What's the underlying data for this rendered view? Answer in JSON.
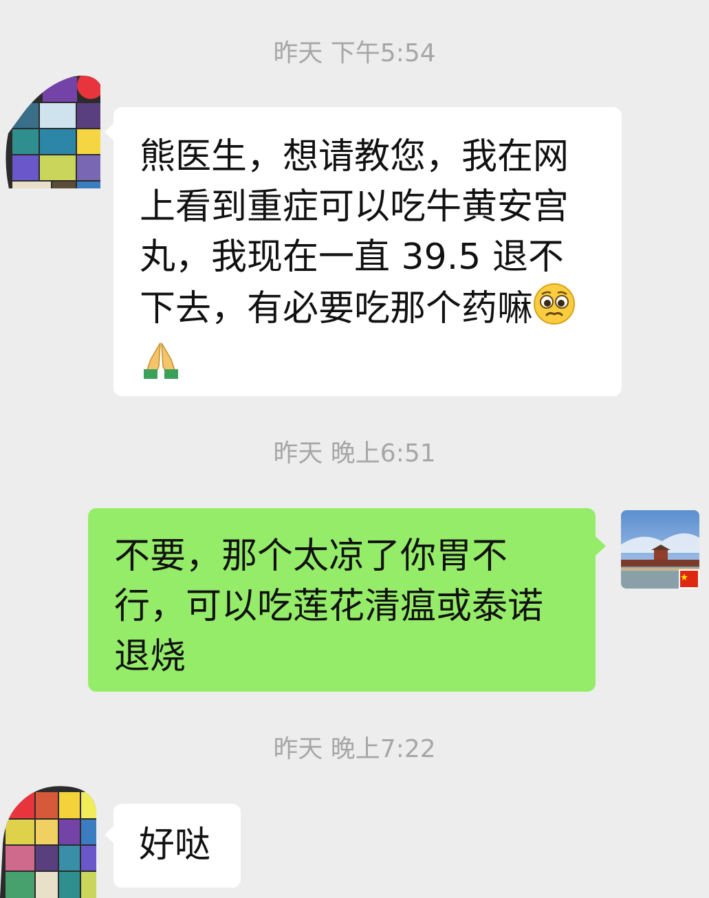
{
  "chat": {
    "timestamps": [
      "昨天 下午5:54",
      "昨天 晚上6:51",
      "昨天 晚上7:22"
    ],
    "messages": [
      {
        "sender": "patient",
        "lines": [
          "熊医生，想请教您，我在网",
          "上看到重症可以吃牛黄安宫",
          "丸，我现在一直 39.5 退不",
          "下去，有必要吃那个药嘛"
        ],
        "emojis": [
          "pleading-face-emoji",
          "folded-hands-emoji"
        ]
      },
      {
        "sender": "doctor",
        "lines": [
          "不要，那个太凉了你胃不",
          "行，可以吃莲花清瘟或泰诺",
          "退烧"
        ]
      },
      {
        "sender": "patient",
        "lines": [
          "好哒"
        ]
      }
    ]
  },
  "colors": {
    "background": "#ededed",
    "incoming_bubble": "#ffffff",
    "outgoing_bubble": "#95ec69",
    "timestamp_text": "#a6a6a6"
  },
  "avatars": {
    "patient": "mosaic-avatar-icon",
    "doctor": "forbidden-city-photo-avatar-icon"
  }
}
